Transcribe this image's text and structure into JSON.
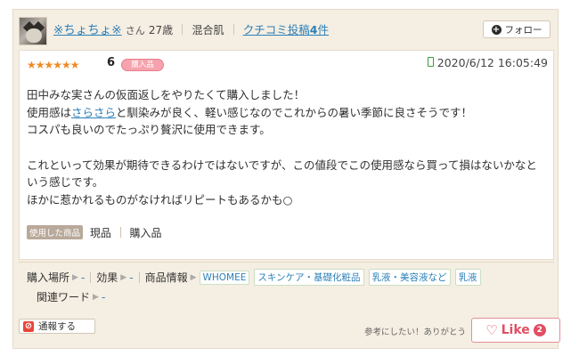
{
  "reviewer": {
    "name": "※ちょちょ※",
    "honorific": "さん",
    "age": "27歳",
    "skin_type": "混合肌",
    "posts_prefix": "クチコミ投稿",
    "posts_count": "4",
    "posts_suffix": "件"
  },
  "follow_button": {
    "icon": "plus-circle-icon",
    "label": "フォロー"
  },
  "rating": {
    "stars": "★★★★★★",
    "score": "6",
    "badge": "購入品"
  },
  "posted_date": "2020/6/12 16:05:49",
  "body": {
    "line1": "田中みな実さんの仮面返しをやりたくて購入しました！",
    "line2_pre": "使用感は",
    "line2_link": "さらさら",
    "line2_post": "と馴染みが良く、軽い感じなのでこれからの暑い季節に良さそうです！",
    "line3": "コスパも良いのでたっぷり贅沢に使用できます。",
    "line4": "これといって効果が期待できるわけではないですが、この値段でこの使用感なら買って損はないかなと",
    "line5": "いう感じです。",
    "line6": "ほかに惹かれるものがなければリピートもあるかも○"
  },
  "used_product": {
    "badge": "使用した商品",
    "items": [
      "現品",
      "購入品"
    ]
  },
  "tags": {
    "place_label": "購入場所",
    "place_value": "-",
    "effect_label": "効果",
    "effect_value": "-",
    "product_info_label": "商品情報",
    "product_info": [
      "WHOMEE",
      "スキンケア・基礎化粧品",
      "乳液・美容液など",
      "乳液"
    ],
    "related_label": "関連ワード",
    "related_value": "-"
  },
  "footer": {
    "report_label": "通報する",
    "helpful_text": "参考にしたい！ありがとう",
    "like_label": "Like",
    "like_count": "2"
  },
  "colors": {
    "card_bg": "#f5eee2",
    "link": "#2b7fb8",
    "star": "#f08a24",
    "like": "#e24e63"
  }
}
